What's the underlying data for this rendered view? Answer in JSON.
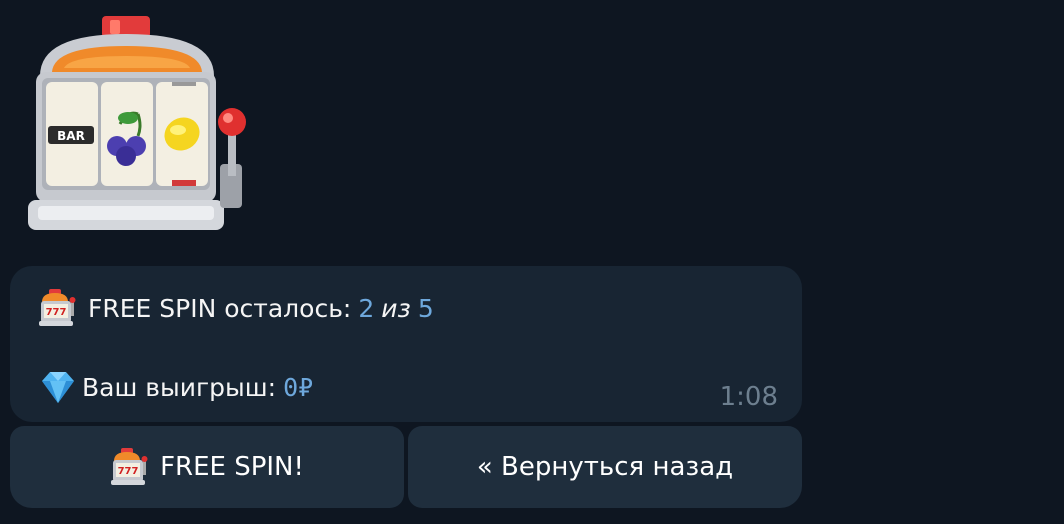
{
  "sticker": {
    "icon": "slot-machine-icon",
    "reel_label": "BAR"
  },
  "message": {
    "line1": {
      "icon": "slot-machine-icon",
      "label": "FREE SPIN осталось:",
      "current": "2",
      "separator": "из",
      "total": "5"
    },
    "line2": {
      "icon": "gem-icon",
      "label": "Ваш выигрыш:",
      "amount": "0₽"
    },
    "time": "1:08"
  },
  "buttons": {
    "free_spin": {
      "icon": "slot-machine-icon",
      "label": "FREE SPIN!"
    },
    "back": {
      "label": "« Вернуться назад"
    }
  },
  "colors": {
    "background": "#0e1621",
    "bubble": "#182533",
    "button": "#1f2e3d",
    "accent_number": "#6ea8dc",
    "time": "#6d7f8f"
  }
}
